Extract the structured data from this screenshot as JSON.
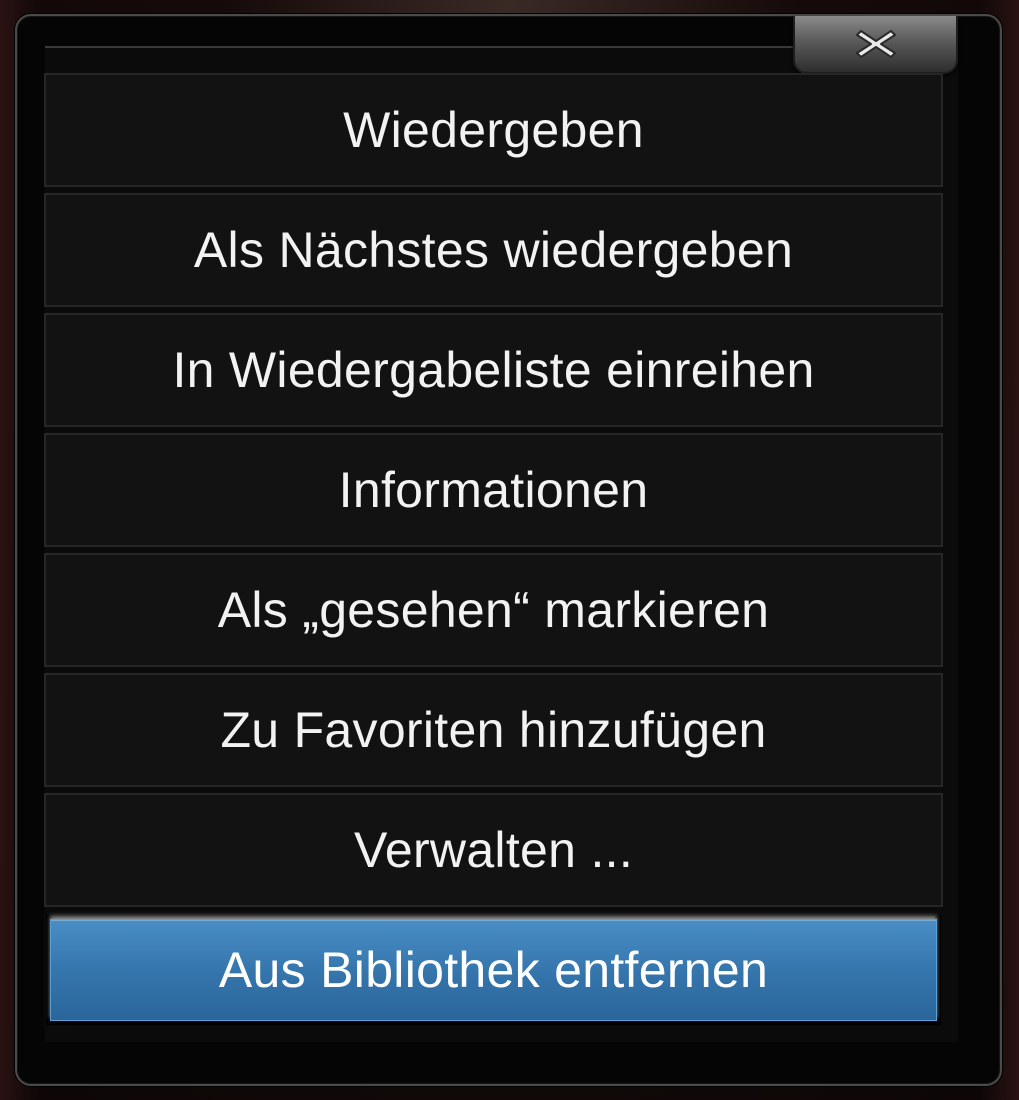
{
  "dialog": {
    "close_icon": "close-icon",
    "items": [
      {
        "label": "Wiedergeben"
      },
      {
        "label": "Als Nächstes wiedergeben"
      },
      {
        "label": "In Wiedergabeliste einreihen"
      },
      {
        "label": "Informationen"
      },
      {
        "label": "Als „gesehen“ markieren"
      },
      {
        "label": "Zu Favoriten hinzufügen"
      },
      {
        "label": "Verwalten ..."
      },
      {
        "label": "Aus Bibliothek entfernen",
        "selected": true
      }
    ]
  },
  "colors": {
    "selected_accent": "#3576ad",
    "item_background": "#121212",
    "text": "#f2f2f2"
  }
}
